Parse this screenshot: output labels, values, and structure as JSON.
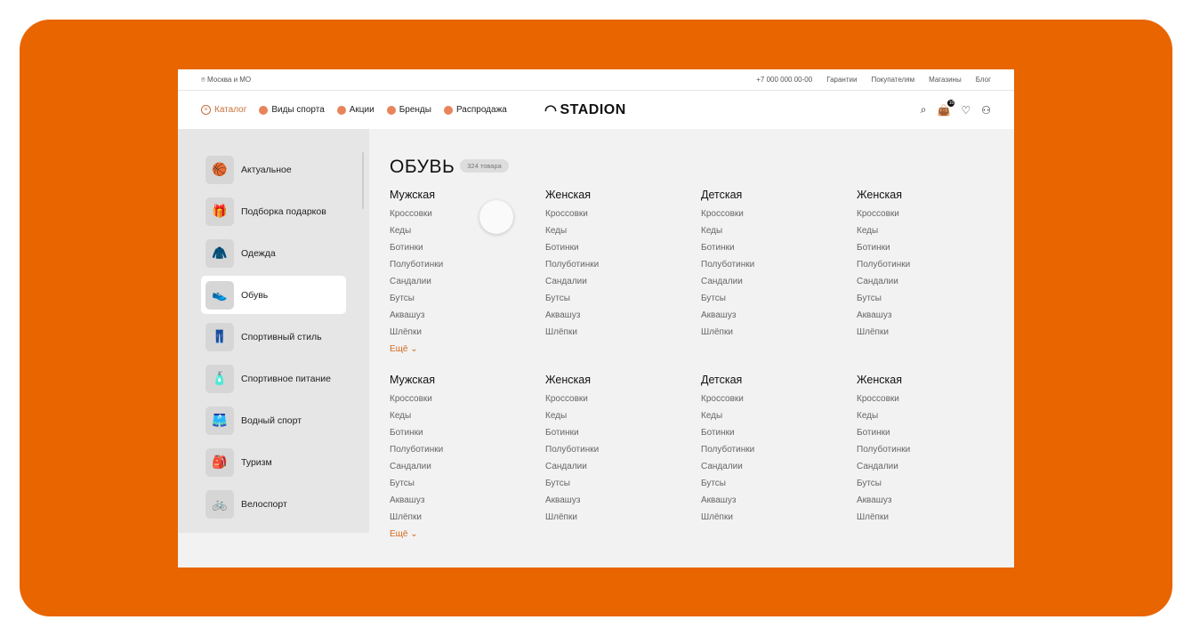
{
  "topbar": {
    "location": "Москва и МО",
    "links": [
      "+7 000 000 00-00",
      "Гарантии",
      "Покупателям",
      "Магазины",
      "Блог"
    ]
  },
  "nav": {
    "catalog": "Каталог",
    "items": [
      "Виды спорта",
      "Акции",
      "Бренды",
      "Распродажа"
    ],
    "logo": "STADION",
    "cart_count": "10"
  },
  "sidebar": [
    {
      "label": "Актуальное",
      "icon": "🏀"
    },
    {
      "label": "Подборка подарков",
      "icon": "🎁"
    },
    {
      "label": "Одежда",
      "icon": "🧥"
    },
    {
      "label": "Обувь",
      "icon": "👟"
    },
    {
      "label": "Спортивный стиль",
      "icon": "👖"
    },
    {
      "label": "Спортивное питание",
      "icon": "🧴"
    },
    {
      "label": "Водный спорт",
      "icon": "🩳"
    },
    {
      "label": "Туризм",
      "icon": "🎒"
    },
    {
      "label": "Велоспорт",
      "icon": "🚲"
    }
  ],
  "main": {
    "title": "ОБУВЬ",
    "count": "324 товара",
    "more": "Ещё",
    "columns": [
      {
        "title": "Мужская",
        "items": [
          "Кроссовки",
          "Кеды",
          "Ботинки",
          "Полуботинки",
          "Сандалии",
          "Бутсы",
          "Аквашуз",
          "Шлёпки"
        ]
      },
      {
        "title": "Женская",
        "items": [
          "Кроссовки",
          "Кеды",
          "Ботинки",
          "Полуботинки",
          "Сандалии",
          "Бутсы",
          "Аквашуз",
          "Шлёпки"
        ]
      },
      {
        "title": "Детская",
        "items": [
          "Кроссовки",
          "Кеды",
          "Ботинки",
          "Полуботинки",
          "Сандалии",
          "Бутсы",
          "Аквашуз",
          "Шлёпки"
        ]
      },
      {
        "title": "Женская",
        "items": [
          "Кроссовки",
          "Кеды",
          "Ботинки",
          "Полуботинки",
          "Сандалии",
          "Бутсы",
          "Аквашуз",
          "Шлёпки"
        ]
      }
    ]
  },
  "colors": {
    "frame": "#e86500",
    "accent": "#d4661e"
  }
}
